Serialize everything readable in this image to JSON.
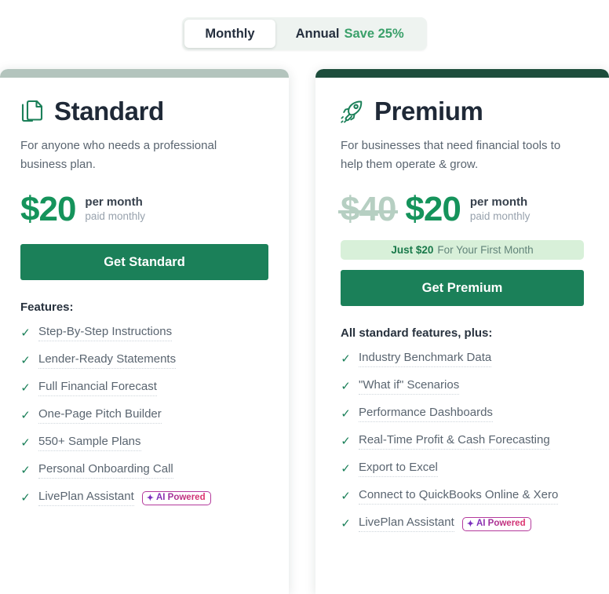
{
  "billing_toggle": {
    "monthly_label": "Monthly",
    "annual_label": "Annual",
    "annual_save_label": "Save 25%",
    "selected": "Monthly"
  },
  "colors": {
    "brand_green": "#1b8059",
    "price_green": "#15935b",
    "premium_bar": "#1d4d3c",
    "standard_bar": "#b3c4bd",
    "promo_bg": "#d8f0d9",
    "ai_badge_start": "#7b2fbe",
    "ai_badge_end": "#e0336a"
  },
  "plans": [
    {
      "id": "standard",
      "icon": "documents-icon",
      "name": "Standard",
      "description": "For anyone who needs a professional business plan.",
      "price_old": null,
      "price": "$20",
      "per_label": "per month",
      "billed_label": "paid monthly",
      "promo": null,
      "cta_label": "Get Standard",
      "features_title": "Features:",
      "features": [
        {
          "label": "Step-By-Step Instructions",
          "badge": null
        },
        {
          "label": "Lender-Ready Statements",
          "badge": null
        },
        {
          "label": "Full Financial Forecast",
          "badge": null
        },
        {
          "label": "One-Page Pitch Builder",
          "badge": null
        },
        {
          "label": "550+ Sample Plans",
          "badge": null
        },
        {
          "label": "Personal Onboarding Call",
          "badge": null
        },
        {
          "label": "LivePlan Assistant",
          "badge": "AI Powered"
        }
      ]
    },
    {
      "id": "premium",
      "icon": "rocket-icon",
      "name": "Premium",
      "description": "For businesses that need financial tools to help them operate & grow.",
      "price_old": "$40",
      "price": "$20",
      "per_label": "per month",
      "billed_label": "paid monthly",
      "promo": {
        "strong": "Just $20",
        "rest": "For Your First Month"
      },
      "cta_label": "Get Premium",
      "features_title": "All standard features, plus:",
      "features": [
        {
          "label": "Industry Benchmark Data",
          "badge": null
        },
        {
          "label": "\"What if\" Scenarios",
          "badge": null
        },
        {
          "label": "Performance Dashboards",
          "badge": null
        },
        {
          "label": "Real-Time Profit & Cash Forecasting",
          "badge": null
        },
        {
          "label": "Export to Excel",
          "badge": null
        },
        {
          "label": "Connect to QuickBooks Online & Xero",
          "badge": null
        },
        {
          "label": "LivePlan Assistant",
          "badge": "AI Powered"
        }
      ]
    }
  ]
}
